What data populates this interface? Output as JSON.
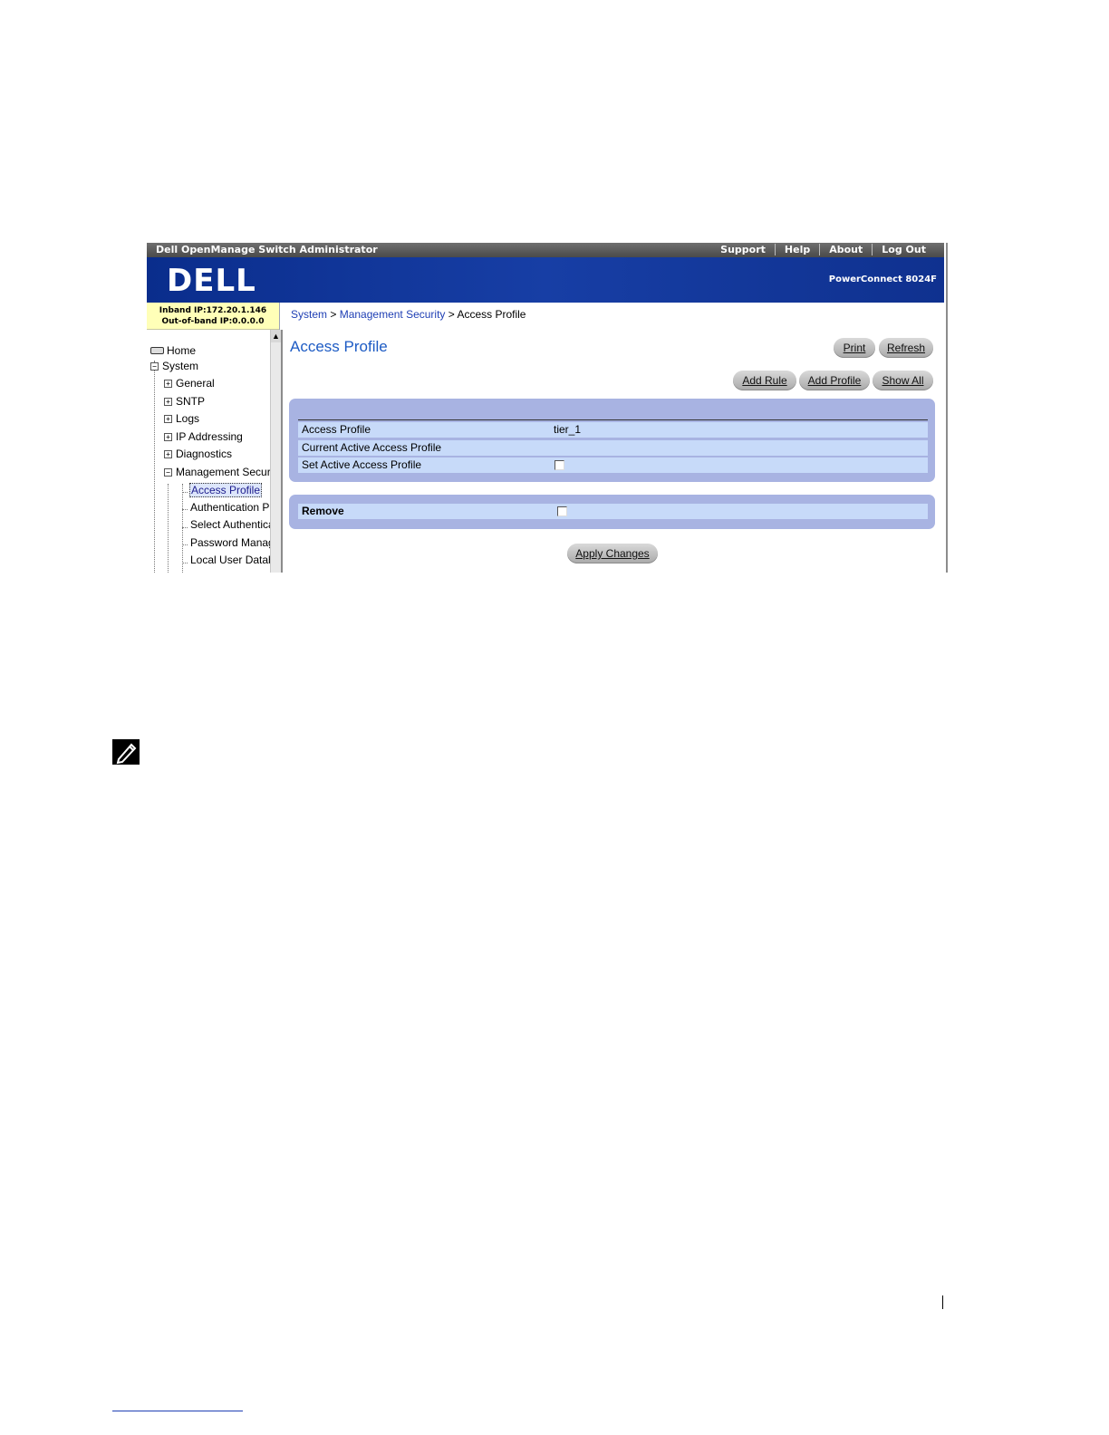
{
  "app": {
    "title": "Dell OpenManage Switch Administrator",
    "top_links": [
      "Support",
      "Help",
      "About",
      "Log Out"
    ],
    "logo_text": "DELL",
    "model": "PowerConnect 8024F"
  },
  "ip": {
    "inband": "Inband IP:172.20.1.146",
    "outofband": "Out-of-band IP:0.0.0.0"
  },
  "breadcrumb": {
    "system": "System",
    "sep": " > ",
    "management_security": "Management Security",
    "current": "Access Profile"
  },
  "nav": {
    "home": "Home",
    "system": "System",
    "general": "General",
    "sntp": "SNTP",
    "logs": "Logs",
    "ip_addressing": "IP Addressing",
    "diagnostics": "Diagnostics",
    "management_security": "Management Securi",
    "access_profile": "Access Profile",
    "authentication": "Authentication Pr",
    "select_auth": "Select Authentica",
    "password": "Password Manag",
    "local_user": "Local User Datab",
    "scroll_up": "▲"
  },
  "main": {
    "title": "Access Profile",
    "print": "Print",
    "refresh": "Refresh",
    "add_rule": "Add Rule",
    "add_profile": "Add Profile",
    "show_all": "Show All",
    "fields": {
      "access_profile_label": "Access Profile",
      "access_profile_value": "tier_1",
      "current_active_label": "Current Active Access Profile",
      "set_active_label": "Set Active Access Profile",
      "remove_label": "Remove"
    },
    "apply": "Apply Changes"
  }
}
